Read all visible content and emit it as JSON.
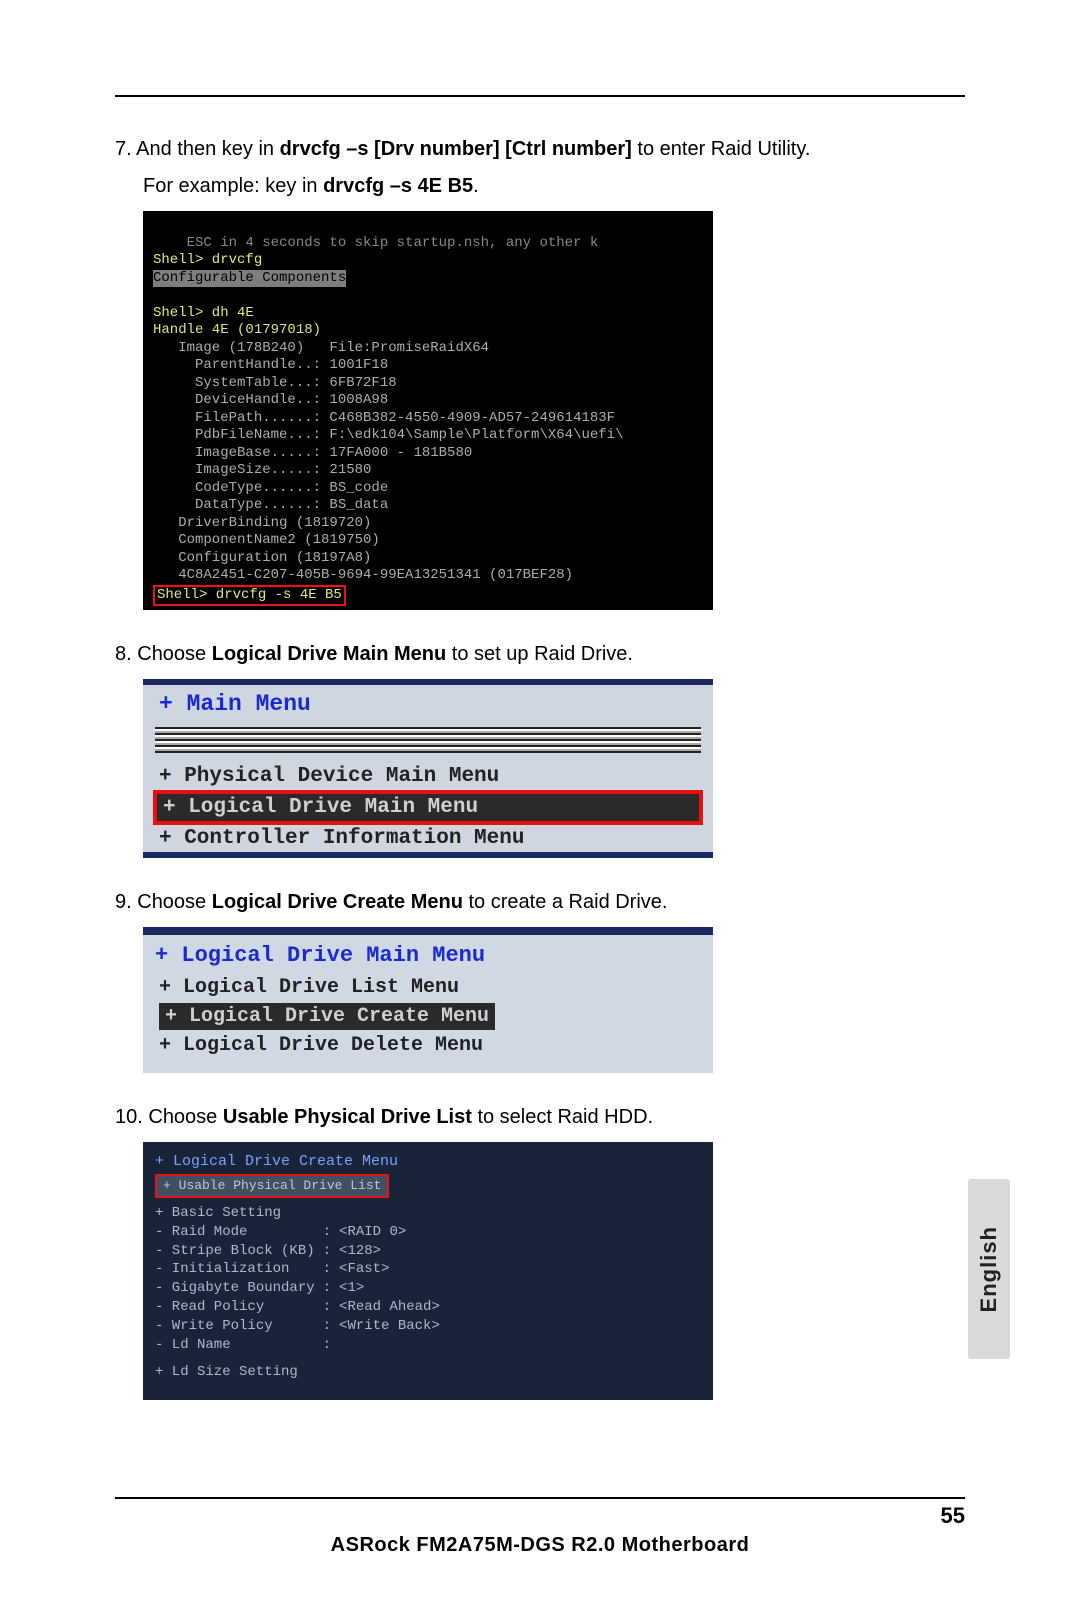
{
  "page_number": "55",
  "footer_title": "ASRock  FM2A75M-DGS R2.0  Motherboard",
  "language_tab": "English",
  "step7": {
    "num": "7.",
    "pre1": " And then key in ",
    "bold1": "drvcfg –s [Drv number] [Ctrl number]",
    "post1": " to enter Raid Utility.",
    "line2_pre": "For example: key in ",
    "line2_bold": "drvcfg –s 4E B5",
    "line2_post": "."
  },
  "shot1": {
    "top": "    ESC in 4 seconds to skip startup.nsh, any other k",
    "shell1": "Shell> drvcfg",
    "conf": "Configurable Components",
    "blank": "",
    "shell2": "Shell> dh 4E",
    "handle": "Handle 4E (01797018)",
    "rows": [
      "   Image (178B240)   File:PromiseRaidX64",
      "     ParentHandle..: 1001F18",
      "     SystemTable...: 6FB72F18",
      "     DeviceHandle..: 1008A98",
      "     FilePath......: C468B382-4550-4909-AD57-249614183F",
      "     PdbFileName...: F:\\edk104\\Sample\\Platform\\X64\\uefi\\",
      "     ImageBase.....: 17FA000 - 181B580",
      "     ImageSize.....: 21580",
      "     CodeType......: BS_code",
      "     DataType......: BS_data",
      "   DriverBinding (1819720)",
      "   ComponentName2 (1819750)",
      "   Configuration (18197A8)",
      "   4C8A2451-C207-405B-9694-99EA13251341 (017BEF28)"
    ],
    "prompt": "Shell> drvcfg -s 4E B5"
  },
  "step8": {
    "num": "8.",
    "pre": " Choose ",
    "bold": "Logical Drive Main Menu",
    "post": " to set up Raid Drive."
  },
  "shot2": {
    "header": "+ Main Menu",
    "r1": "+ Physical Device Main Menu",
    "r2": "+ Logical Drive Main Menu",
    "r3": "+ Controller Information Menu"
  },
  "step9": {
    "num": "9.",
    "pre": " Choose ",
    "bold": "Logical Drive Create Menu",
    "post": " to create a Raid Drive."
  },
  "shot3": {
    "header": "+ Logical Drive Main Menu",
    "r1": "+ Logical Drive List Menu",
    "r2": "+ Logical Drive Create Menu",
    "r3": "+ Logical Drive Delete Menu"
  },
  "step10": {
    "num": "10.",
    "pre": " Choose ",
    "bold": "Usable Physical Drive List",
    "post": " to select Raid HDD."
  },
  "shot4": {
    "header": "+ Logical Drive Create Menu",
    "sel": "+ Usable Physical Drive List",
    "basic": "+ Basic Setting",
    "rows": [
      {
        "k": "- Raid Mode",
        "v": "<RAID 0>"
      },
      {
        "k": "- Stripe Block (KB)",
        "v": "<128>"
      },
      {
        "k": "- Initialization",
        "v": "<Fast>"
      },
      {
        "k": "- Gigabyte Boundary",
        "v": "<1>"
      },
      {
        "k": "- Read Policy",
        "v": "<Read Ahead>"
      },
      {
        "k": "- Write Policy",
        "v": "<Write Back>"
      },
      {
        "k": "- Ld Name",
        "v": ""
      }
    ],
    "last": "+ Ld Size Setting"
  }
}
